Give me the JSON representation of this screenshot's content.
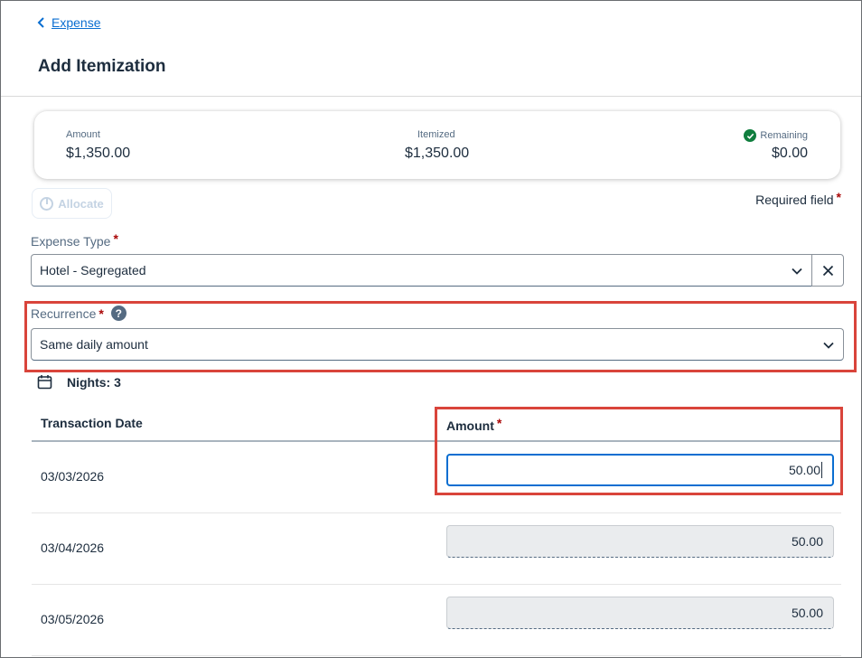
{
  "header": {
    "back_label": "Expense",
    "title": "Add Itemization"
  },
  "summary": {
    "amount_label": "Amount",
    "amount_value": "$1,350.00",
    "itemized_label": "Itemized",
    "itemized_value": "$1,350.00",
    "remaining_label": "Remaining",
    "remaining_value": "$0.00",
    "remaining_status_color": "#107e3e"
  },
  "toolbar": {
    "allocate_label": "Allocate",
    "required_note": "Required field"
  },
  "form": {
    "expense_type_label": "Expense Type",
    "expense_type_value": "Hotel - Segregated",
    "recurrence_label": "Recurrence",
    "recurrence_value": "Same daily amount",
    "nights_label": "Nights: 3"
  },
  "table": {
    "columns": [
      "Transaction Date",
      "Amount"
    ],
    "rows": [
      {
        "date": "03/03/2026",
        "amount": "50.00"
      },
      {
        "date": "03/04/2026",
        "amount": "50.00"
      },
      {
        "date": "03/05/2026",
        "amount": "50.00"
      }
    ]
  },
  "colors": {
    "link": "#0a6ed1",
    "required_asterisk": "#aa0808",
    "highlight_box": "#d9443b",
    "focus_border": "#0a6ed1"
  }
}
